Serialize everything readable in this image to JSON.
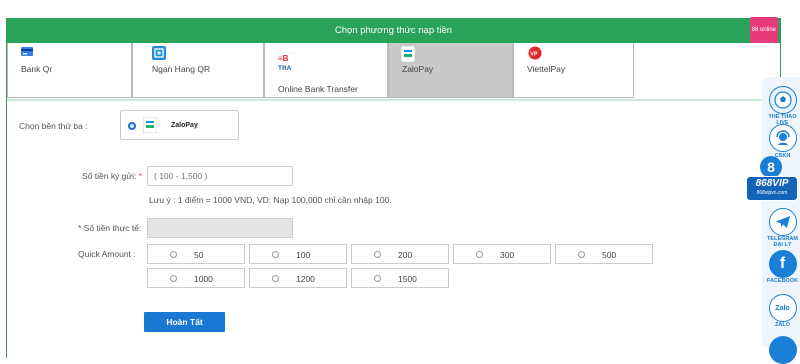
{
  "header": {
    "title": "Chọn phương thức nạp tiền",
    "badge": "88 online"
  },
  "tabs": [
    {
      "label": "Bank Qr",
      "icon": "bank-card-icon"
    },
    {
      "label": "Ngan Hang QR",
      "icon": "qr-code-icon"
    },
    {
      "label": "Online Bank Transfer",
      "icon": "ebtra-icon"
    },
    {
      "label": "ZaloPay",
      "icon": "zalopay-icon",
      "active": true
    },
    {
      "label": "ViettelPay",
      "icon": "viettelpay-icon"
    }
  ],
  "third_party": {
    "label": "Chọn bên thứ ba :",
    "option": "ZaloPay",
    "selected": true
  },
  "deposit": {
    "label": "Số tiền ký gửi:",
    "required_mark": "*",
    "placeholder": "( 100 - 1,500 )",
    "note": "Lưu ý : 1 điểm = 1000 VND, VD: Nạp 100,000 chỉ cần nhập 100."
  },
  "actual": {
    "label": "* Số tiền thực tế:"
  },
  "quick_amount": {
    "label": "Quick Amount :",
    "row1": [
      "50",
      "100",
      "200",
      "300",
      "500"
    ],
    "row2": [
      "1000",
      "1200",
      "1500"
    ]
  },
  "submit_label": "Hoàn Tất",
  "sidebar": {
    "items": [
      "THỂ THAO LIVE",
      "CSKH",
      "868VIP",
      "868vipvn.com",
      "TELEGRAM ĐẠI LÝ",
      "FACEBOOK",
      "ZALO"
    ],
    "colors": {
      "accent": "#1a7fd6",
      "brand_green": "#29a35a",
      "button_blue": "#1978d2"
    }
  }
}
